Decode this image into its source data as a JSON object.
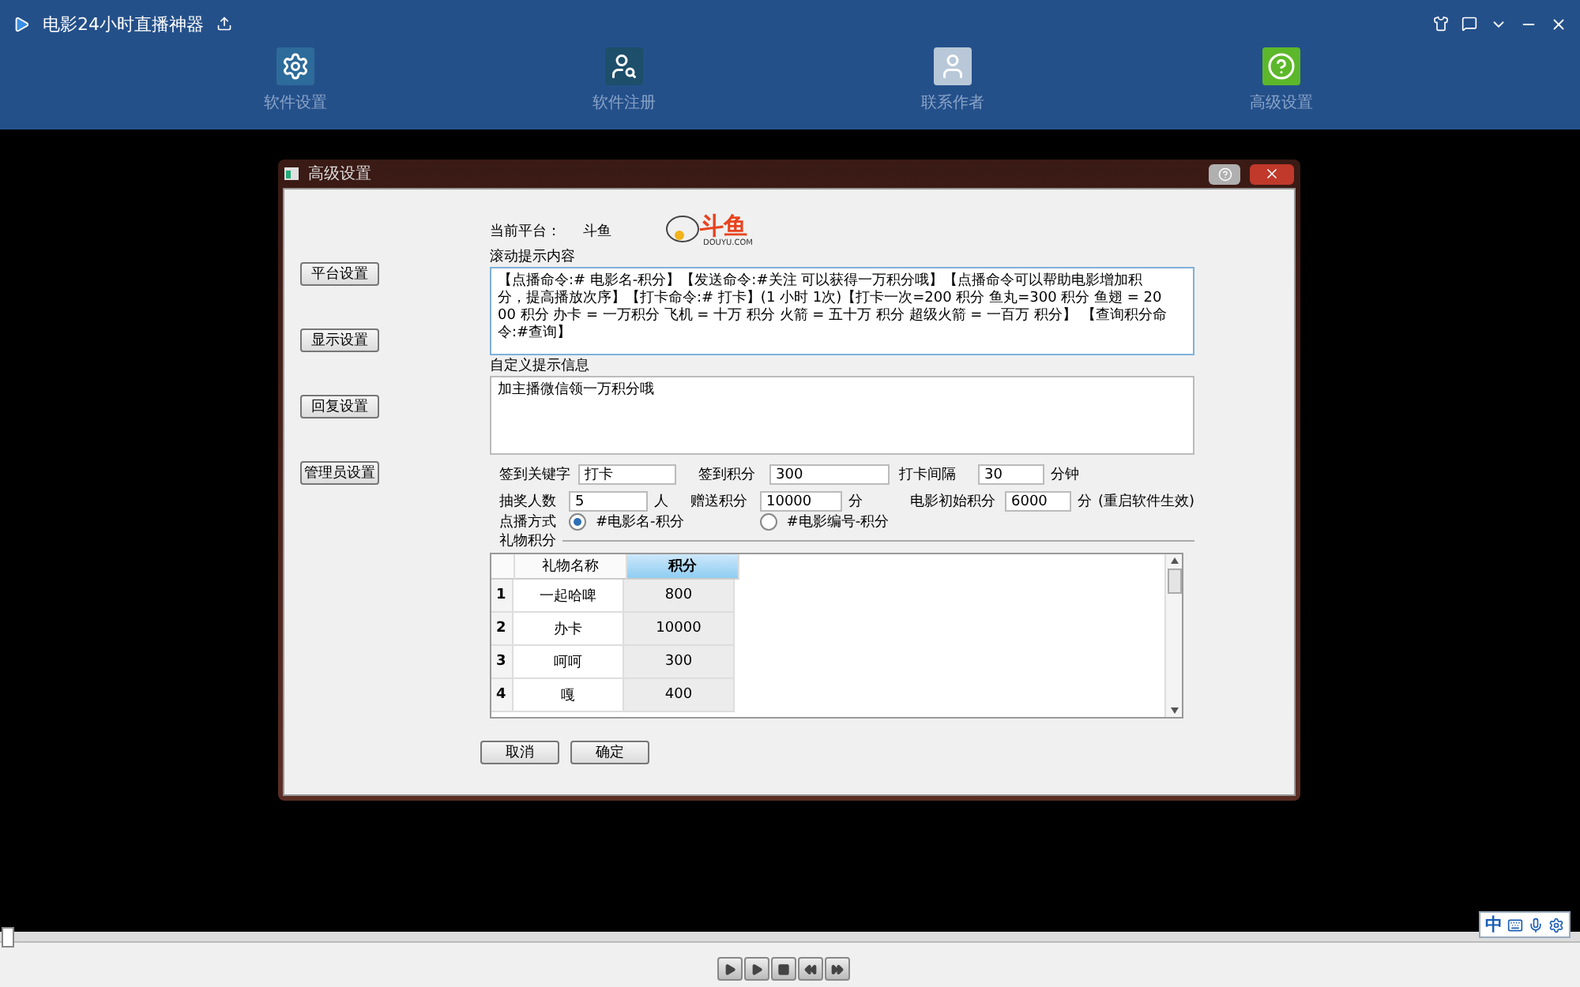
{
  "app": {
    "title": "电影24小时直播神器"
  },
  "nav": [
    {
      "label": "软件设置",
      "kind": "gear"
    },
    {
      "label": "软件注册",
      "kind": "register"
    },
    {
      "label": "联系作者",
      "kind": "person"
    },
    {
      "label": "高级设置",
      "kind": "help"
    }
  ],
  "dialog": {
    "title": "高级设置",
    "side_buttons": [
      "平台设置",
      "显示设置",
      "回复设置",
      "管理员设置"
    ],
    "platform_label": "当前平台：",
    "platform_value": "斗鱼",
    "logo_text": "斗鱼",
    "logo_sub": "DOUYU.COM",
    "scroll_label": "滚动提示内容",
    "scroll_text": "【点播命令:# 电影名-积分】【发送命令:#关注 可以获得一万积分哦】【点播命令可以帮助电影增加积分，提高播放次序】【打卡命令:# 打卡】(1 小时 1次)【打卡一次=200 积分   鱼丸=300 积分   鱼翅 = 2000 积分 办卡 = 一万积分   飞机 = 十万 积分   火箭 = 五十万 积分   超级火箭 = 一百万 积分】  【查询积分命令:#查询】",
    "custom_label": "自定义提示信息",
    "custom_text": "加主播微信领一万积分哦",
    "fields": [
      {
        "label": "签到关键字",
        "value": "打卡"
      },
      {
        "label": "签到积分",
        "value": "300"
      },
      {
        "label": "打卡间隔",
        "value": "30",
        "unit": "分钟"
      },
      {
        "label": "抽奖人数",
        "value": "5",
        "unit": "人"
      },
      {
        "label": "赠送积分",
        "value": "10000",
        "unit": "分"
      },
      {
        "label": "电影初始积分",
        "value": "6000",
        "unit": "分",
        "note": "(重启软件生效)"
      }
    ],
    "mode_label": "点播方式",
    "modes": [
      {
        "label": "#电影名-积分",
        "selected": true
      },
      {
        "label": "#电影编号-积分",
        "selected": false
      }
    ],
    "gift_label": "礼物积分",
    "table": {
      "columns": [
        {
          "label": "礼物名称",
          "selected": false
        },
        {
          "label": "积分",
          "selected": true
        }
      ],
      "rows": [
        {
          "index": "1",
          "name": "一起哈啤",
          "points": "800"
        },
        {
          "index": "2",
          "name": "办卡",
          "points": "10000"
        },
        {
          "index": "3",
          "name": "呵呵",
          "points": "300"
        },
        {
          "index": "4",
          "name": "嘎",
          "points": "400"
        }
      ]
    },
    "buttons": [
      "取消",
      "确定"
    ]
  },
  "ime": {
    "label": "中"
  }
}
